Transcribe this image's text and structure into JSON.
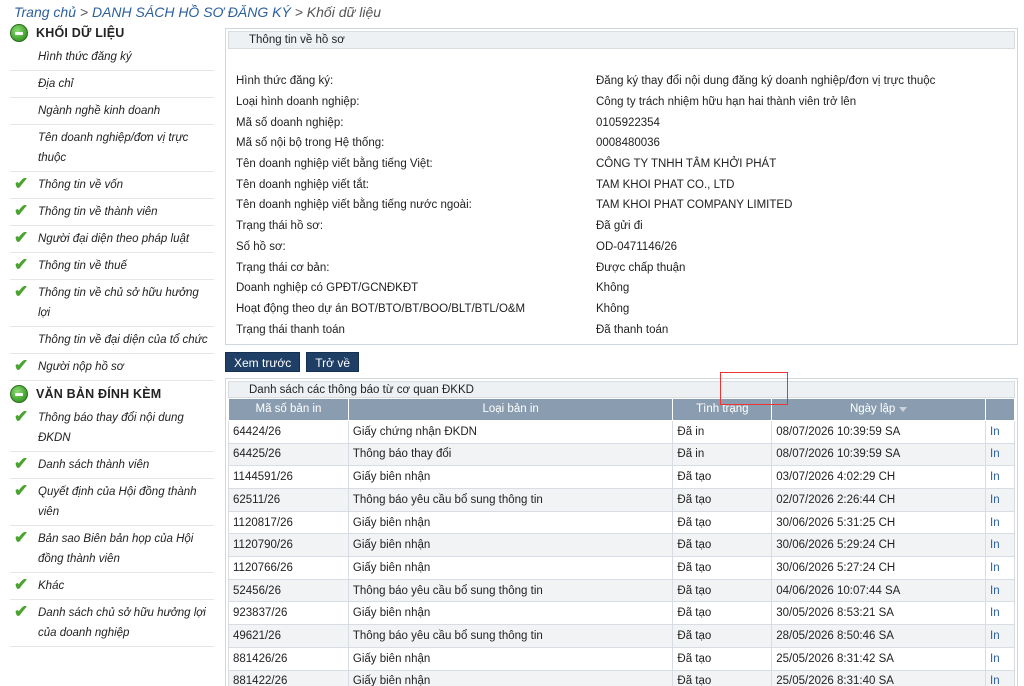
{
  "breadcrumb": {
    "home": "Trang chủ",
    "list": "DANH SÁCH HỒ SƠ ĐĂNG KÝ",
    "current": "Khối dữ liệu"
  },
  "sidebar": {
    "section1": "KHỐI DỮ LIỆU",
    "items1": [
      {
        "label": "Hình thức đăng ký",
        "checked": false
      },
      {
        "label": "Địa chỉ",
        "checked": false
      },
      {
        "label": "Ngành nghề kinh doanh",
        "checked": false
      },
      {
        "label": "Tên doanh nghiệp/đơn vị trực thuộc",
        "checked": false
      },
      {
        "label": "Thông tin về vốn",
        "checked": true
      },
      {
        "label": "Thông tin về thành viên",
        "checked": true
      },
      {
        "label": "Người đại diện theo pháp luật",
        "checked": true
      },
      {
        "label": "Thông tin về thuế",
        "checked": true
      },
      {
        "label": "Thông tin về chủ sở hữu hưởng lợi",
        "checked": true
      },
      {
        "label": "Thông tin về đại diện của tổ chức",
        "checked": false
      },
      {
        "label": "Người nộp hồ sơ",
        "checked": true
      }
    ],
    "section2": "VĂN BẢN ĐÍNH KÈM",
    "items2": [
      {
        "label": "Thông báo thay đổi nội dung ĐKDN",
        "checked": true
      },
      {
        "label": "Danh sách thành viên",
        "checked": true
      },
      {
        "label": "Quyết định của Hội đồng thành viên",
        "checked": true
      },
      {
        "label": "Bản sao Biên bản họp của Hội đồng thành viên",
        "checked": true
      },
      {
        "label": "Khác",
        "checked": true
      },
      {
        "label": "Danh sách chủ sở hữu hưởng lợi của doanh nghiệp",
        "checked": true
      }
    ]
  },
  "info_panel": {
    "title": "Thông tin về hồ sơ",
    "rows": [
      {
        "k": "Hình thức đăng ký:",
        "v": "Đăng ký thay đổi nội dung đăng ký doanh nghiệp/đơn vị trực thuộc"
      },
      {
        "k": "Loại hình doanh nghiệp:",
        "v": "Công ty trách nhiệm hữu hạn hai thành viên trở lên"
      },
      {
        "k": "Mã số doanh nghiệp:",
        "v": "0105922354"
      },
      {
        "k": "Mã số nội bộ trong Hệ thống:",
        "v": "0008480036"
      },
      {
        "k": "Tên doanh nghiệp viết bằng tiếng Việt:",
        "v": "CÔNG TY TNHH TÂM KHỞI PHÁT"
      },
      {
        "k": "Tên doanh nghiệp viết tắt:",
        "v": "TAM KHOI PHAT CO., LTD"
      },
      {
        "k": "Tên doanh nghiệp viết bằng tiếng nước ngoài:",
        "v": "TAM KHOI PHAT COMPANY LIMITED"
      },
      {
        "k": "Trạng thái hồ sơ:",
        "v": "Đã gửi đi"
      },
      {
        "k": "Số hồ sơ:",
        "v": "OD-0471146/26"
      },
      {
        "k": "Trạng thái cơ bản:",
        "v": "Được chấp thuận"
      },
      {
        "k": "Doanh nghiệp có GPĐT/GCNĐKĐT",
        "v": "Không"
      },
      {
        "k": "Hoạt động theo dự án BOT/BTO/BT/BOO/BLT/BTL/O&M",
        "v": "Không"
      },
      {
        "k": "Trạng thái thanh toán",
        "v": "Đã thanh toán"
      }
    ]
  },
  "buttons": {
    "preview": "Xem trước",
    "back": "Trở về"
  },
  "notice_panel": {
    "title": "Danh sách các thông báo từ cơ quan ĐKKD",
    "headers": [
      "Mã số bản in",
      "Loại bản in",
      "Tình trạng",
      "Ngày lập",
      ""
    ],
    "rows": [
      [
        "64424/26",
        "Giấy chứng nhận ĐKDN",
        "Đã in",
        "08/07/2026 10:39:59 SA",
        "In"
      ],
      [
        "64425/26",
        "Thông báo thay đổi",
        "Đã in",
        "08/07/2026 10:39:59 SA",
        "In"
      ],
      [
        "1144591/26",
        "Giấy biên nhận",
        "Đã tạo",
        "03/07/2026 4:02:29 CH",
        "In"
      ],
      [
        "62511/26",
        "Thông báo yêu cầu bổ sung thông tin",
        "Đã tạo",
        "02/07/2026 2:26:44 CH",
        "In"
      ],
      [
        "1120817/26",
        "Giấy biên nhận",
        "Đã tạo",
        "30/06/2026 5:31:25 CH",
        "In"
      ],
      [
        "1120790/26",
        "Giấy biên nhận",
        "Đã tạo",
        "30/06/2026 5:29:24 CH",
        "In"
      ],
      [
        "1120766/26",
        "Giấy biên nhận",
        "Đã tạo",
        "30/06/2026 5:27:24 CH",
        "In"
      ],
      [
        "52456/26",
        "Thông báo yêu cầu bổ sung thông tin",
        "Đã tạo",
        "04/06/2026 10:07:44 SA",
        "In"
      ],
      [
        "923837/26",
        "Giấy biên nhận",
        "Đã tạo",
        "30/05/2026 8:53:21 SA",
        "In"
      ],
      [
        "49621/26",
        "Thông báo yêu cầu bổ sung thông tin",
        "Đã tạo",
        "28/05/2026 8:50:46 SA",
        "In"
      ],
      [
        "881426/26",
        "Giấy biên nhận",
        "Đã tạo",
        "25/05/2026 8:31:42 SA",
        "In"
      ],
      [
        "881422/26",
        "Giấy biên nhận",
        "Đã tạo",
        "25/05/2026 8:31:40 SA",
        "In"
      ]
    ]
  },
  "colors": {
    "header_bg": "#8a9db0",
    "button_bg": "#1f3f66",
    "check": "#4aa32e",
    "link": "#2b5f9e"
  },
  "icons": {
    "section": "green-circle-icon",
    "check": "check-icon",
    "sort": "sort-down-icon"
  }
}
